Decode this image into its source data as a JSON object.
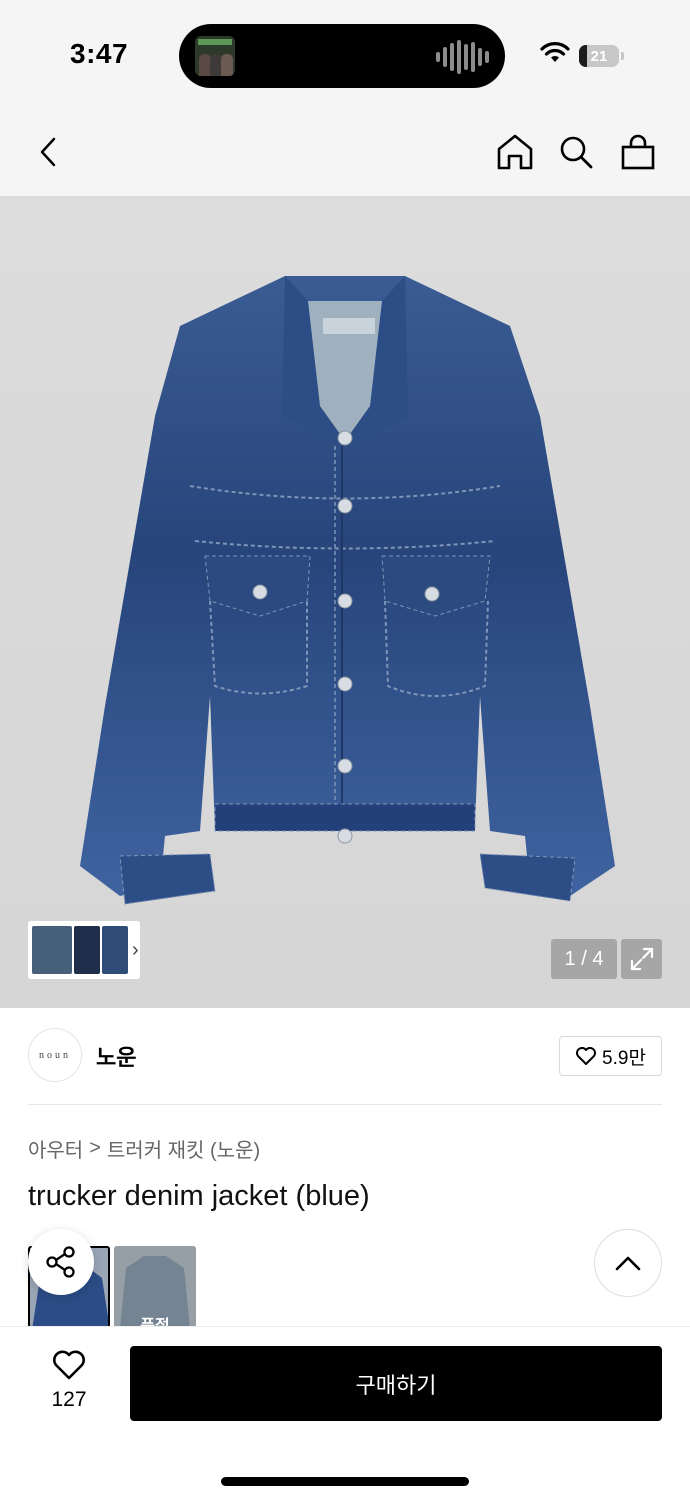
{
  "status_bar": {
    "time": "3:47",
    "battery": "21",
    "battery_level": 0.21,
    "icons": [
      "now-playing-art",
      "audio-waveform-icon",
      "wifi-icon",
      "battery-icon"
    ]
  },
  "nav": {
    "icons": [
      "back-chevron-icon",
      "home-icon",
      "search-icon",
      "shopping-bag-icon"
    ]
  },
  "gallery": {
    "pager": "1 / 4",
    "current_index": 1,
    "total": 4,
    "icons": [
      "thumbnail-strip",
      "chevron-right-icon",
      "expand-icon"
    ]
  },
  "brand": {
    "logo_text": "noun",
    "name": "노운",
    "likes": "5.9만"
  },
  "breadcrumb": {
    "category": "아우터",
    "separator": ">",
    "sub_category": "트러커 재킷 (노운)"
  },
  "product": {
    "title": "trucker denim jacket (blue)",
    "option_2_label": "품절"
  },
  "bottom_bar": {
    "wish_count": "127",
    "buy_label": "구매하기"
  },
  "colors": {
    "accent": "#000000",
    "background": "#f5f5f5",
    "denim": "#2f4f85"
  }
}
